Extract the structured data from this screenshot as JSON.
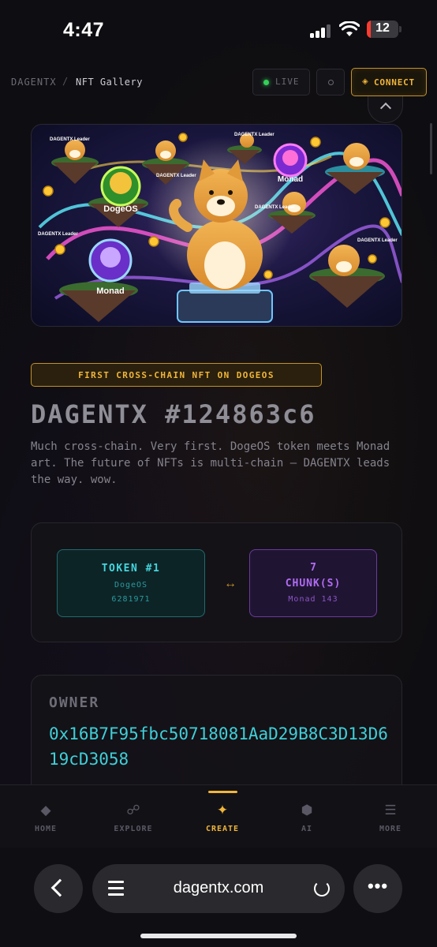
{
  "status_bar": {
    "time": "4:47",
    "battery_level": "12"
  },
  "header": {
    "breadcrumb_root": "DAGENTX",
    "breadcrumb_separator": "/",
    "breadcrumb_current": "NFT Gallery",
    "live_label": "LIVE",
    "connect_label": "CONNECT"
  },
  "nft": {
    "image_labels": {
      "dogeos": "DogeOS",
      "monad": "Monad",
      "leader": "DAGENTX Leader"
    },
    "badge": "FIRST CROSS-CHAIN NFT ON DOGEOS",
    "title": "DAGENTX #124863c6",
    "description": "Much cross-chain. Very first. DogeOS token meets Monad art. The future of NFTs is multi-chain — DAGENTX leads the way. wow."
  },
  "chain_link": {
    "token": {
      "title": "TOKEN #1",
      "chain": "DogeOS",
      "id": "6281971"
    },
    "arrow": "↔",
    "chunks": {
      "count": "7",
      "label": "CHUNK(S)",
      "chain": "Monad 143"
    }
  },
  "owner": {
    "label": "OWNER",
    "address": "0x16B7F95fbc50718081AaD29B8C3D13D619cD3058"
  },
  "bottom_nav": {
    "items": [
      {
        "label": "HOME",
        "icon": "diamond-icon"
      },
      {
        "label": "EXPLORE",
        "icon": "link-icon"
      },
      {
        "label": "CREATE",
        "icon": "sparkle-icon",
        "active": true
      },
      {
        "label": "AI",
        "icon": "hexagon-icon"
      },
      {
        "label": "MORE",
        "icon": "menu-icon"
      }
    ]
  },
  "browser": {
    "url": "dagentx.com"
  },
  "colors": {
    "accent_gold": "#f0b53a",
    "cyan": "#43d6de",
    "purple": "#b06cf2",
    "live_green": "#34d058"
  }
}
